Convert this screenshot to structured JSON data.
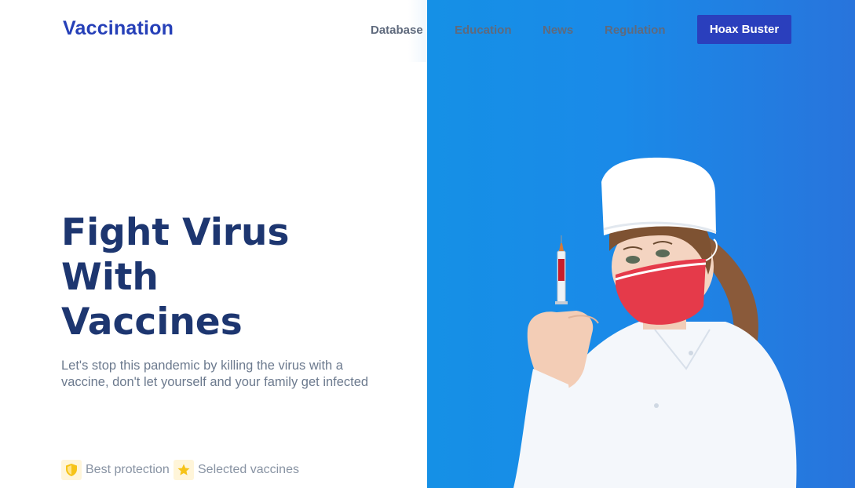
{
  "header": {
    "logo": "Vaccination",
    "nav": [
      "Database",
      "Education",
      "News",
      "Regulation"
    ],
    "cta_label": "Hoax Buster"
  },
  "hero": {
    "title_lines": [
      "Fight Virus",
      "With",
      "Vaccines"
    ],
    "subtitle": "Let's stop this pandemic by killing the virus with a vaccine, don't let yourself and your family get infected",
    "features": [
      {
        "icon": "shield-icon",
        "label": "Best protection"
      },
      {
        "icon": "star-icon",
        "label": "Selected vaccines"
      }
    ],
    "image": "nurse-with-syringe-photo"
  },
  "colors": {
    "brand": "#2640b8",
    "cta_bg": "#2a3fbd",
    "title": "#1d3670",
    "hero_bg": "#1590e6",
    "mask": "#e53a4a"
  }
}
